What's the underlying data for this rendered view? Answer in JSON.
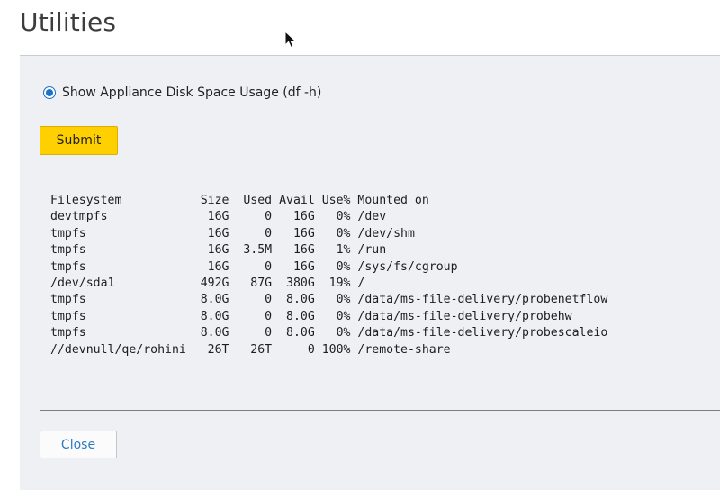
{
  "page": {
    "title": "Utilities"
  },
  "options": {
    "radio_label": "Show Appliance Disk Space Usage (df -h)",
    "selected": true
  },
  "actions": {
    "submit_label": "Submit",
    "close_label": "Close"
  },
  "df_output": {
    "header": "Filesystem           Size  Used Avail Use% Mounted on",
    "rows": [
      "devtmpfs              16G     0   16G   0% /dev",
      "tmpfs                 16G     0   16G   0% /dev/shm",
      "tmpfs                 16G  3.5M   16G   1% /run",
      "tmpfs                 16G     0   16G   0% /sys/fs/cgroup",
      "/dev/sda1            492G   87G  380G  19% /",
      "tmpfs                8.0G     0  8.0G   0% /data/ms-file-delivery/probenetflow",
      "tmpfs                8.0G     0  8.0G   0% /data/ms-file-delivery/probehw",
      "tmpfs                8.0G     0  8.0G   0% /data/ms-file-delivery/probescaleio",
      "//devnull/qe/rohini   26T   26T     0 100% /remote-share"
    ]
  },
  "colors": {
    "accent": "#1a73c8",
    "submit_bg": "#ffd000",
    "panel_bg": "#eef0f4",
    "link": "#2d7bbf"
  },
  "icons": {
    "cursor": "mouse-pointer-icon"
  }
}
